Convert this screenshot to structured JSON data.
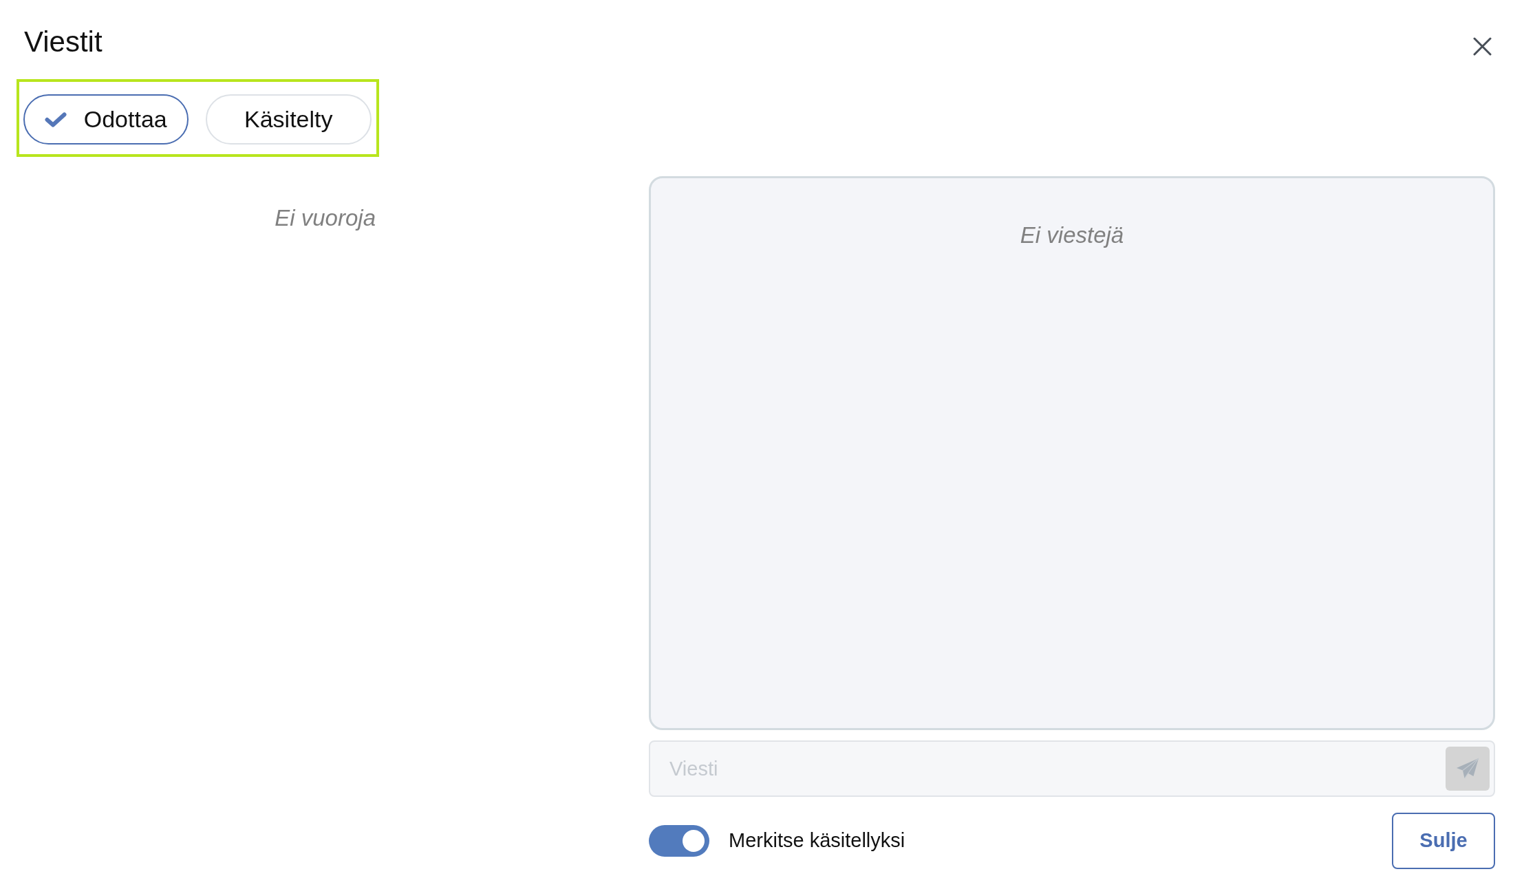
{
  "dialog": {
    "title": "Viestit"
  },
  "filters": [
    {
      "label": "Odottaa",
      "selected": true
    },
    {
      "label": "Käsitelty",
      "selected": false
    }
  ],
  "shifts_list": {
    "empty_text": "Ei vuoroja"
  },
  "messages_list": {
    "empty_text": "Ei viestejä"
  },
  "composer": {
    "placeholder": "Viesti",
    "send_button": {
      "disabled": true
    }
  },
  "mark_handled": {
    "label": "Merkitse käsitellyksi",
    "on": true
  },
  "footer_button": {
    "label": "Sulje"
  }
}
